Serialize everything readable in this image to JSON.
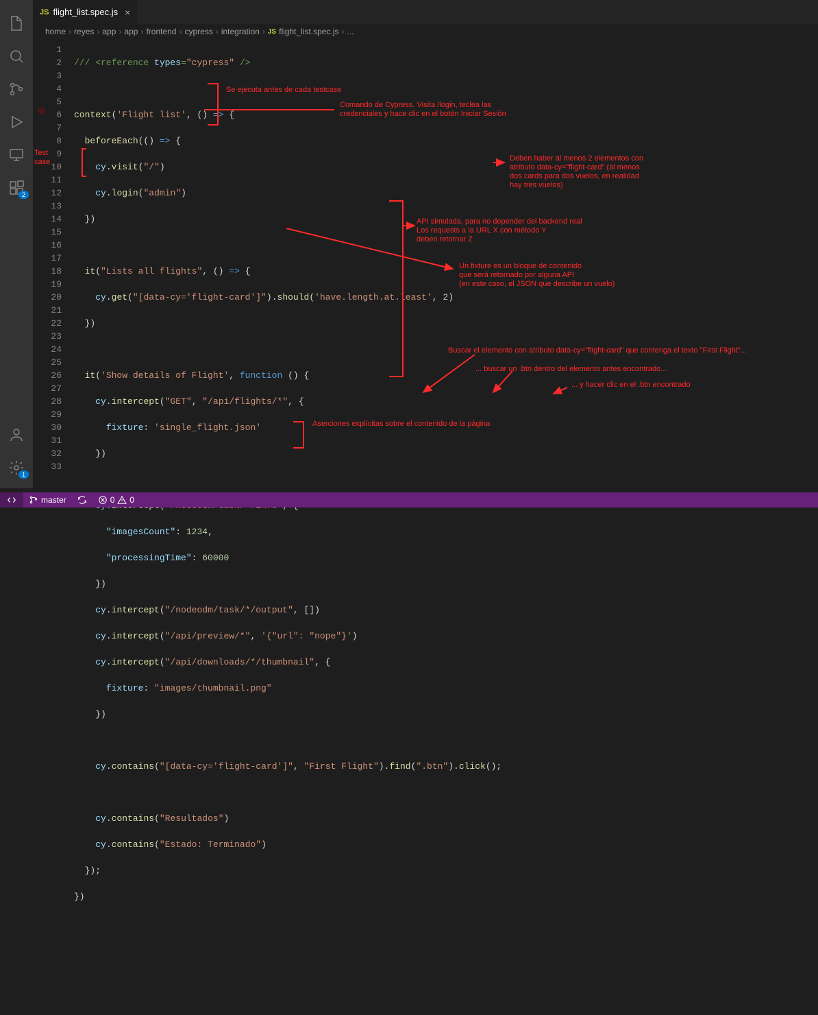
{
  "tabs": {
    "file": "flight_list.spec.js"
  },
  "breadcrumbs": [
    "home",
    "reyes",
    "app",
    "app",
    "frontend",
    "cypress",
    "integration",
    "flight_list.spec.js",
    "..."
  ],
  "activity_badges": {
    "extensions": "2",
    "settings": "1"
  },
  "annotations": {
    "testcase": "Test\ncase",
    "before": "Se ejecuta antes de cada testcase",
    "login": "Comando de Cypress. Visita /login, teclea las\ncredenciales y hace clic en el botón Iniciar Sesión",
    "atleast": "Deben haber al menos 2 elementos con\natributo data-cy=\"flight-card\" (al menos\ndos cards para dos vuelos, en realidad\nhay tres vuelos)",
    "api": "API simulada, para no depender del backend real\nLos requests a la URL X con método Y\ndeben retornar Z",
    "fixture": "Un fixture es un bloque de contenido\nque será retornado por alguna API\n(en este caso, el JSON que describe un vuelo)",
    "contains1": "Buscar el elemento con atributo data-cy=\"flight-card\" que contenga el texto \"First Flight\"...",
    "find": "... buscar un .btn dentro del elemento antes encontrado...",
    "click": "... y hacer clic en el .btn encontrado",
    "assert": "Aserciones explícitas sobre el contenido de la página"
  },
  "status": {
    "branch": "master",
    "errors": "0",
    "warnings": "0"
  },
  "code": {
    "l1": {
      "a": "/// <reference ",
      "b": "types",
      "c": "=",
      "d": "\"cypress\"",
      "e": " />"
    },
    "l3": {
      "a": "context",
      "b": "(",
      "c": "'Flight list'",
      "d": ", () ",
      "e": "=>",
      "f": " {"
    },
    "l4": {
      "a": "beforeEach",
      "b": "(() ",
      "c": "=>",
      "d": " {"
    },
    "l5": {
      "a": "cy",
      "b": ".",
      "c": "visit",
      "d": "(",
      "e": "\"/\"",
      "f": ")"
    },
    "l6": {
      "a": "cy",
      "b": ".",
      "c": "login",
      "d": "(",
      "e": "\"admin\"",
      "f": ")"
    },
    "l7": "  })",
    "l9": {
      "a": "it",
      "b": "(",
      "c": "\"Lists all flights\"",
      "d": ", () ",
      "e": "=>",
      "f": " {"
    },
    "l10": {
      "a": "cy",
      "b": ".",
      "c": "get",
      "d": "(",
      "e": "\"[data-cy='flight-card']\"",
      "f": ").",
      "g": "should",
      "h": "(",
      "i": "'have.length.at.least'",
      "j": ", ",
      "k": "2",
      "l": ")"
    },
    "l11": "  })",
    "l13": {
      "a": "it",
      "b": "(",
      "c": "'Show details of Flight'",
      "d": ", ",
      "e": "function",
      "f": " () {"
    },
    "l14": {
      "a": "cy",
      "b": ".",
      "c": "intercept",
      "d": "(",
      "e": "\"GET\"",
      "f": ", ",
      "g": "\"/api/flights/*\"",
      "h": ", {"
    },
    "l15": {
      "a": "fixture",
      "b": ": ",
      "c": "'single_flight.json'"
    },
    "l16": "    })",
    "l18": {
      "a": "cy",
      "b": ".",
      "c": "intercept",
      "d": "(",
      "e": "\"/nodeodm/task/*/info\"",
      "f": ", {"
    },
    "l19": {
      "a": "\"imagesCount\"",
      "b": ": ",
      "c": "1234",
      "d": ","
    },
    "l20": {
      "a": "\"processingTime\"",
      "b": ": ",
      "c": "60000"
    },
    "l21": "    })",
    "l22": {
      "a": "cy",
      "b": ".",
      "c": "intercept",
      "d": "(",
      "e": "\"/nodeodm/task/*/output\"",
      "f": ", [])"
    },
    "l23": {
      "a": "cy",
      "b": ".",
      "c": "intercept",
      "d": "(",
      "e": "\"/api/preview/*\"",
      "f": ", ",
      "g": "'{\"url\": \"nope\"}'",
      "h": ")"
    },
    "l24": {
      "a": "cy",
      "b": ".",
      "c": "intercept",
      "d": "(",
      "e": "\"/api/downloads/*/thumbnail\"",
      "f": ", {"
    },
    "l25": {
      "a": "fixture",
      "b": ": ",
      "c": "\"images/thumbnail.png\""
    },
    "l26": "    })",
    "l28": {
      "a": "cy",
      "b": ".",
      "c": "contains",
      "d": "(",
      "e": "\"[data-cy='flight-card']\"",
      "f": ", ",
      "g": "\"First Flight\"",
      "h": ").",
      "i": "find",
      "j": "(",
      "k": "\".btn\"",
      "l": ").",
      "m": "click",
      "n": "();"
    },
    "l30": {
      "a": "cy",
      "b": ".",
      "c": "contains",
      "d": "(",
      "e": "\"Resultados\"",
      "f": ")"
    },
    "l31": {
      "a": "cy",
      "b": ".",
      "c": "contains",
      "d": "(",
      "e": "\"Estado: Terminado\"",
      "f": ")"
    },
    "l32": "  });",
    "l33": "})"
  }
}
